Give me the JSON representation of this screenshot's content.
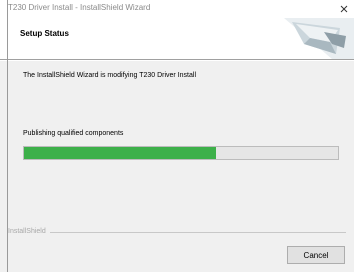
{
  "window": {
    "title": "T230 Driver Install - InstallShield Wizard",
    "close_glyph": "×"
  },
  "header": {
    "title": "Setup Status",
    "graphic_icon": "installshield-banner-icon"
  },
  "main": {
    "status_text": "The InstallShield Wizard is modifying T230 Driver Install",
    "progress_label": "Publishing qualified components",
    "progress_fraction": 0.61,
    "progress_color": "#3db04a"
  },
  "footer": {
    "brand": "InstallShield",
    "cancel_label": "Cancel"
  }
}
